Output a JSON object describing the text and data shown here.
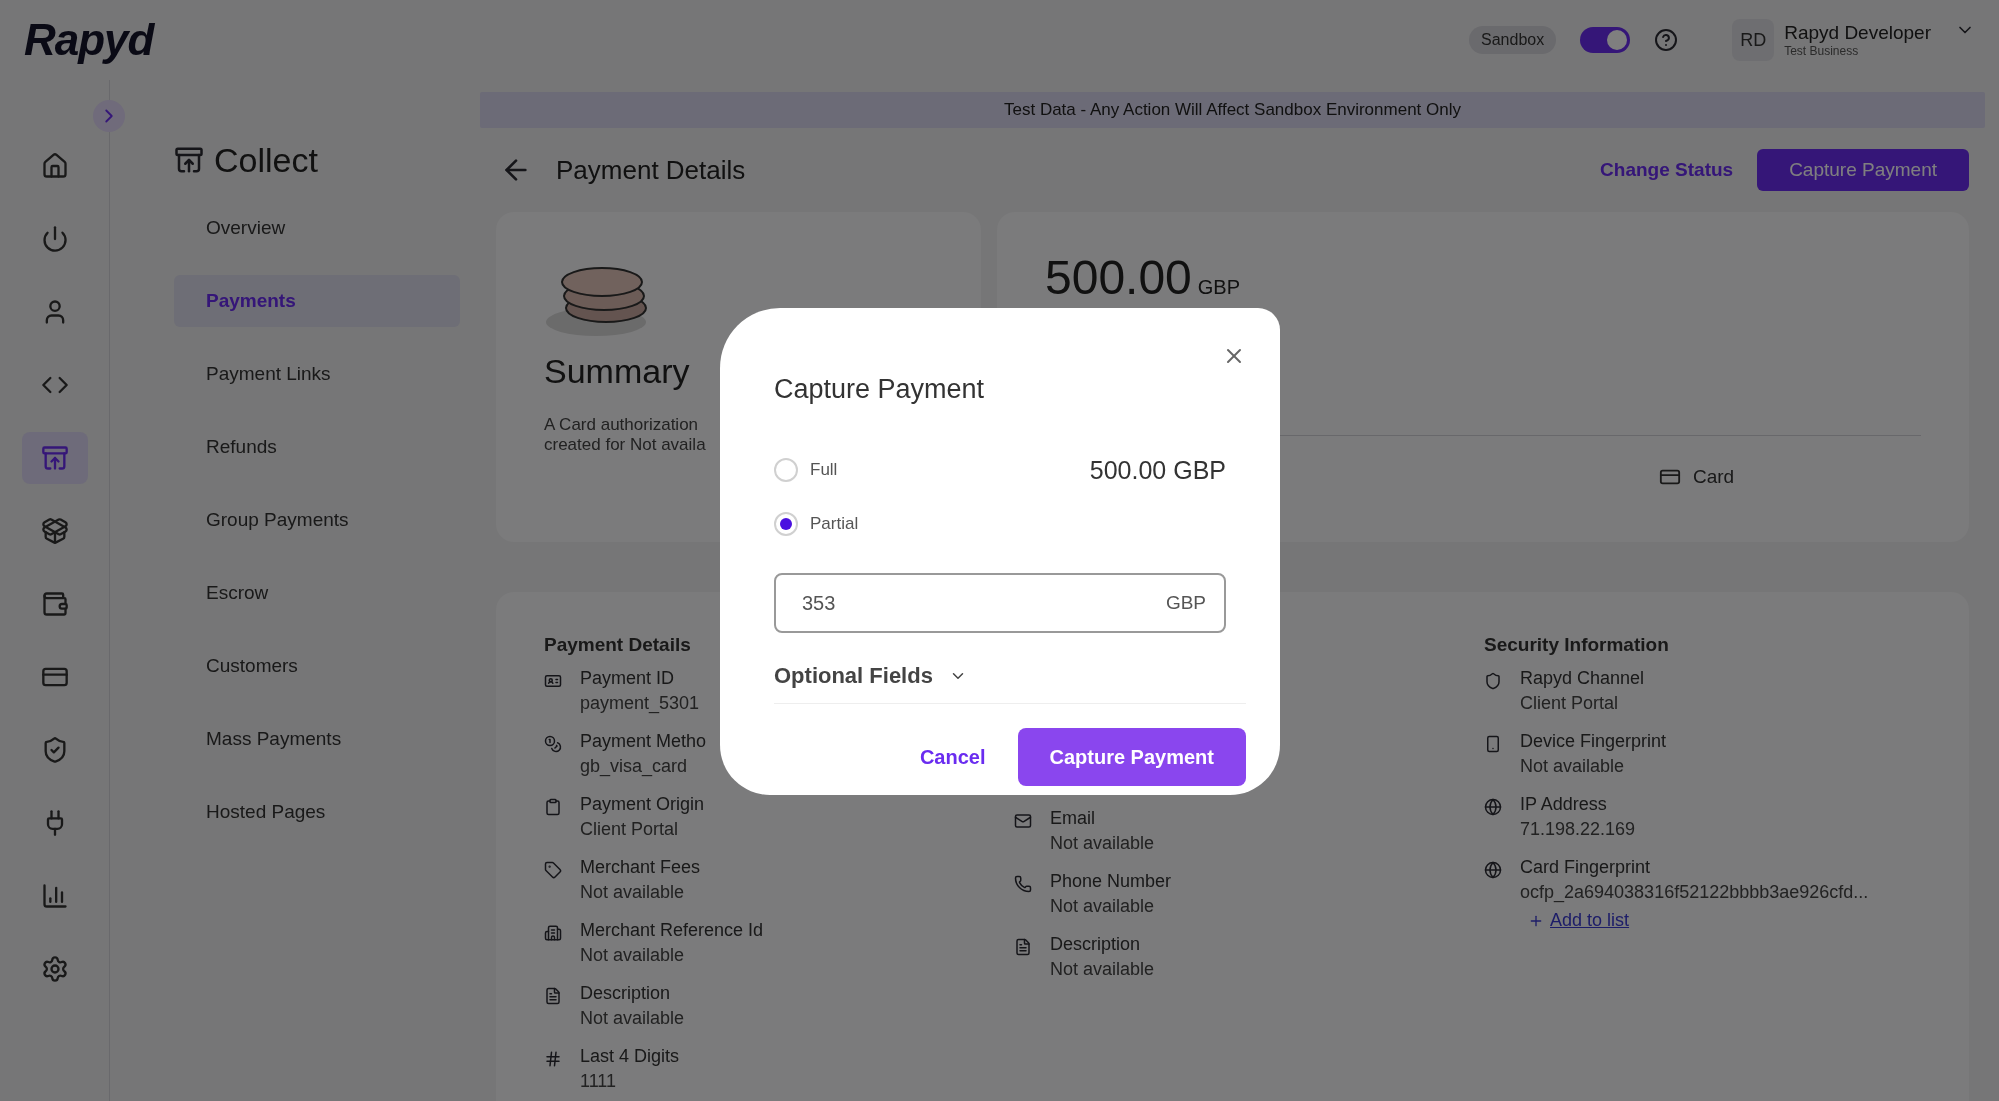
{
  "topbar": {
    "logo": "Rapyd",
    "env_badge": "Sandbox",
    "sandbox_toggle": {
      "on": true
    },
    "user": {
      "initials": "RD",
      "name": "Rapyd Developer",
      "business": "Test Business"
    }
  },
  "rail": {
    "items": [
      {
        "selected": false
      },
      {
        "selected": false
      },
      {
        "selected": false
      },
      {
        "selected": false
      },
      {
        "selected": true
      },
      {
        "selected": false
      },
      {
        "selected": false
      },
      {
        "selected": false
      },
      {
        "selected": false
      },
      {
        "selected": false
      },
      {
        "selected": false
      },
      {
        "selected": false
      }
    ]
  },
  "subnav": {
    "title": "Collect",
    "items": [
      {
        "label": "Overview",
        "selected": false
      },
      {
        "label": "Payments",
        "selected": true
      },
      {
        "label": "Payment Links",
        "selected": false
      },
      {
        "label": "Refunds",
        "selected": false
      },
      {
        "label": "Group Payments",
        "selected": false
      },
      {
        "label": "Escrow",
        "selected": false
      },
      {
        "label": "Customers",
        "selected": false
      },
      {
        "label": "Mass Payments",
        "selected": false
      },
      {
        "label": "Hosted Pages",
        "selected": false
      }
    ]
  },
  "banner": "Test Data - Any Action Will Affect Sandbox Environment Only",
  "header": {
    "title": "Payment Details",
    "link": "Change Status",
    "button": "Capture Payment"
  },
  "summary": {
    "title": "Summary",
    "lines": [
      "A Card authorization",
      "created for Not availa"
    ]
  },
  "amount": {
    "value": "500.00",
    "currency": "GBP",
    "method": "Card"
  },
  "details": {
    "columns": [
      {
        "title": "Payment Details",
        "items": [
          {
            "label": "Payment ID",
            "value": "payment_5301"
          },
          {
            "label": "Payment Metho",
            "value": "gb_visa_card"
          },
          {
            "label": "Payment Origin",
            "value": "Client Portal"
          },
          {
            "label": "Merchant Fees",
            "value": "Not available"
          },
          {
            "label": "Merchant Reference Id",
            "value": "Not available"
          },
          {
            "label": "Description",
            "value": "Not available"
          },
          {
            "label": "Last 4 Digits",
            "value": "1111"
          }
        ]
      },
      {
        "items": [
          {
            "label": "Email",
            "value": "Not available"
          },
          {
            "label": "Phone Number",
            "value": "Not available"
          },
          {
            "label": "Description",
            "value": "Not available"
          }
        ]
      },
      {
        "title": "Security Information",
        "items": [
          {
            "label": "Rapyd Channel",
            "value": "Client Portal"
          },
          {
            "label": "Device Fingerprint",
            "value": "Not available"
          },
          {
            "label": "IP Address",
            "value": "71.198.22.169"
          },
          {
            "label": "Card Fingerprint",
            "value": "ocfp_2a694038316f52122bbbb3ae926cfd..."
          }
        ],
        "add_link": "Add to list"
      }
    ]
  },
  "modal": {
    "title": "Capture Payment",
    "options": [
      {
        "label": "Full",
        "selected": false,
        "amount": "500.00 GBP"
      },
      {
        "label": "Partial",
        "selected": true
      }
    ],
    "amount_field": {
      "value": "353",
      "suffix": "GBP"
    },
    "optional": {
      "label": "Optional Fields",
      "expanded": false
    },
    "cancel": "Cancel",
    "confirm": "Capture Payment"
  }
}
